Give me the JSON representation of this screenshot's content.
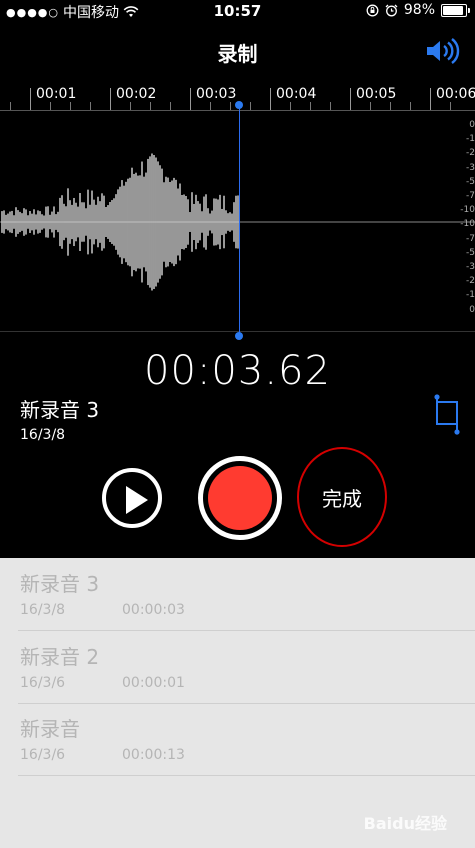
{
  "status_bar": {
    "signal_dots": "●●●●○",
    "carrier": "中国移动",
    "time": "10:57",
    "battery": "98%"
  },
  "header": {
    "title": "录制",
    "speaker_icon": "speaker-icon"
  },
  "timeline": {
    "ticks": [
      "00:01",
      "00:02",
      "00:03",
      "00:04",
      "00:05",
      "00:06"
    ]
  },
  "db_scale": [
    "0",
    "-1",
    "-2",
    "-3",
    "-5",
    "-7",
    "-10",
    "-10",
    "-7",
    "-5",
    "-3",
    "-2",
    "-1",
    "0"
  ],
  "recorder": {
    "elapsed": "00:03.62",
    "name": "新录音 3",
    "date": "16/3/8",
    "done_label": "完成"
  },
  "recordings": [
    {
      "name": "新录音 3",
      "date": "16/3/8",
      "duration": "00:00:03"
    },
    {
      "name": "新录音 2",
      "date": "16/3/6",
      "duration": "00:00:01"
    },
    {
      "name": "新录音",
      "date": "16/3/6",
      "duration": "00:00:13"
    }
  ],
  "colors": {
    "accent_blue": "#2b7af0",
    "record_red": "#ff3b30",
    "list_bg": "#e6e6e6"
  },
  "watermark": "Baidu经验"
}
